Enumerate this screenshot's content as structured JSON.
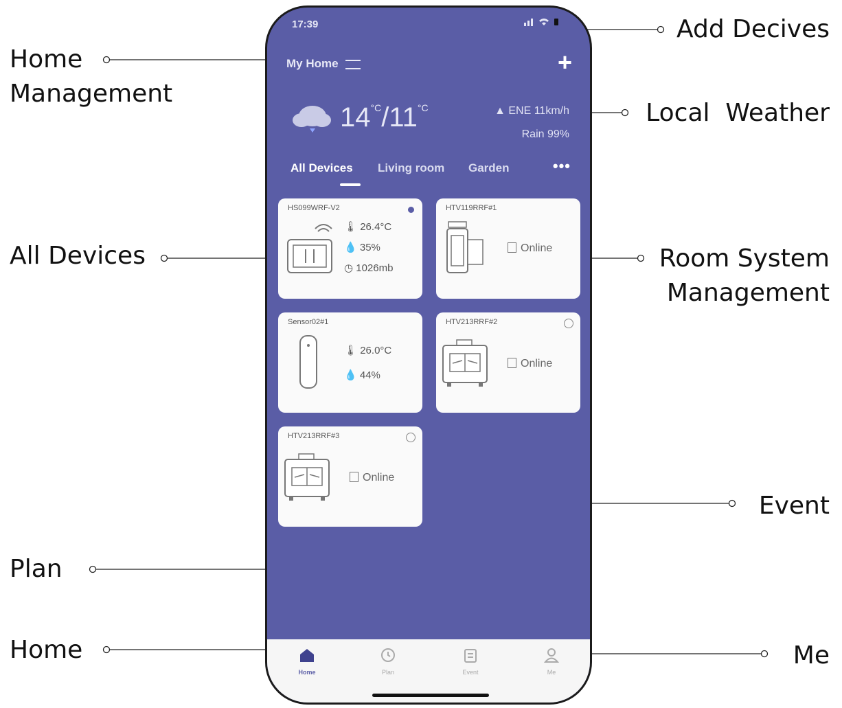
{
  "callouts": {
    "add_devices": "Add Decives",
    "home_management_line1": "Home",
    "home_management_line2": "Management",
    "local_weather": "Local  Weather",
    "all_devices": "All Devices",
    "room_system_line1": "Room System",
    "room_system_line2": "Management",
    "event": "Event",
    "plan": "Plan",
    "home": "Home",
    "me": "Me"
  },
  "phone": {
    "status_time": "17:39",
    "home_title": "My Home",
    "weather": {
      "icon": "cloud-rain-icon",
      "temp_high": "14",
      "temp_low": "11",
      "unit": "°C",
      "wind": "ENE 11km/h",
      "rain": "Rain 99%"
    },
    "tabs": [
      {
        "label": "All Devices",
        "active": true
      },
      {
        "label": "Living room",
        "active": false
      },
      {
        "label": "Garden",
        "active": false
      }
    ],
    "more_label": "•••",
    "cards": [
      {
        "name": "HS099WRF-V2",
        "temperature": "26.4°C",
        "humidity": "35%",
        "pressure": "1026mb"
      },
      {
        "name": "HTV119RRF#1",
        "status": "Online"
      },
      {
        "name": "Sensor02#1",
        "temperature": "26.0°C",
        "humidity": "44%"
      },
      {
        "name": "HTV213RRF#2",
        "status": "Online"
      },
      {
        "name": "HTV213RRF#3",
        "status": "Online"
      }
    ],
    "nav": [
      {
        "label": "Home",
        "icon": "home-icon",
        "active": true
      },
      {
        "label": "Plan",
        "icon": "clock-icon",
        "active": false
      },
      {
        "label": "Event",
        "icon": "event-icon",
        "active": false
      },
      {
        "label": "Me",
        "icon": "person-icon",
        "active": false
      }
    ]
  }
}
